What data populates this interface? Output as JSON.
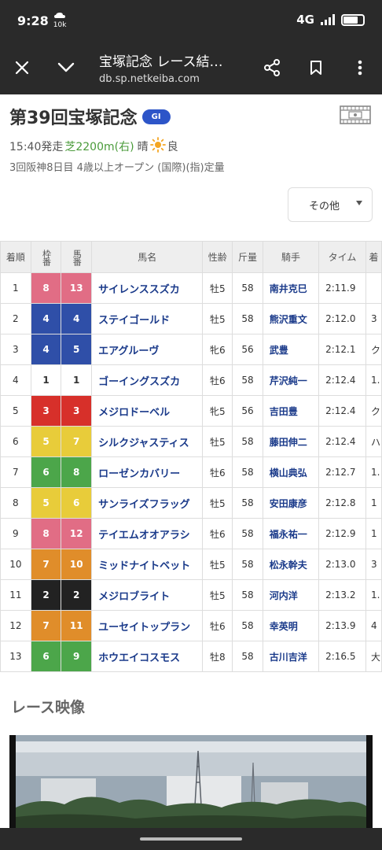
{
  "status": {
    "time": "9:28",
    "sub_label": "10k",
    "network": "4G"
  },
  "appbar": {
    "title": "宝塚記念 レース結…",
    "url": "db.sp.netkeiba.com"
  },
  "race": {
    "title": "第39回宝塚記念",
    "grade": "GI",
    "start": "15:40発走",
    "course": "芝2200m(右)",
    "weather": "晴",
    "going": "良",
    "details": "3回阪神8日目 4歳以上オープン (国際)(指)定量"
  },
  "other_button": "その他",
  "table": {
    "headers": [
      "着順",
      "枠番",
      "馬番",
      "馬名",
      "性齢",
      "斤量",
      "騎手",
      "タイム",
      "着"
    ],
    "rows": [
      {
        "rank": "1",
        "frame": "8",
        "frame_color": "pink",
        "num": "13",
        "name": "サイレンススズカ",
        "sex": "牡5",
        "kin": "58",
        "jockey": "南井克巳",
        "time": "2:11.9",
        "margin": ""
      },
      {
        "rank": "2",
        "frame": "4",
        "frame_color": "blue",
        "num": "4",
        "name": "ステイゴールド",
        "sex": "牡5",
        "kin": "58",
        "jockey": "熊沢重文",
        "time": "2:12.0",
        "margin": "3"
      },
      {
        "rank": "3",
        "frame": "4",
        "frame_color": "blue",
        "num": "5",
        "name": "エアグルーヴ",
        "sex": "牝6",
        "kin": "56",
        "jockey": "武豊",
        "time": "2:12.1",
        "margin": "ク"
      },
      {
        "rank": "4",
        "frame": "1",
        "frame_color": "white",
        "num": "1",
        "name": "ゴーイングスズカ",
        "sex": "牡6",
        "kin": "58",
        "jockey": "芹沢純一",
        "time": "2:12.4",
        "margin": "1."
      },
      {
        "rank": "5",
        "frame": "3",
        "frame_color": "red",
        "num": "3",
        "name": "メジロドーベル",
        "sex": "牝5",
        "kin": "56",
        "jockey": "吉田豊",
        "time": "2:12.4",
        "margin": "ク"
      },
      {
        "rank": "6",
        "frame": "5",
        "frame_color": "yellow",
        "num": "7",
        "name": "シルクジャスティス",
        "sex": "牡5",
        "kin": "58",
        "jockey": "藤田伸二",
        "time": "2:12.4",
        "margin": "ハ"
      },
      {
        "rank": "7",
        "frame": "6",
        "frame_color": "green",
        "num": "8",
        "name": "ローゼンカバリー",
        "sex": "牡6",
        "kin": "58",
        "jockey": "横山典弘",
        "time": "2:12.7",
        "margin": "1."
      },
      {
        "rank": "8",
        "frame": "5",
        "frame_color": "yellow",
        "num": "6",
        "name": "サンライズフラッグ",
        "sex": "牡5",
        "kin": "58",
        "jockey": "安田康彦",
        "time": "2:12.8",
        "margin": "1"
      },
      {
        "rank": "9",
        "frame": "8",
        "frame_color": "pink",
        "num": "12",
        "name": "テイエムオオアラシ",
        "sex": "牡6",
        "kin": "58",
        "jockey": "福永祐一",
        "time": "2:12.9",
        "margin": "1"
      },
      {
        "rank": "10",
        "frame": "7",
        "frame_color": "orange",
        "num": "10",
        "name": "ミッドナイトベット",
        "sex": "牡5",
        "kin": "58",
        "jockey": "松永幹夫",
        "time": "2:13.0",
        "margin": "3"
      },
      {
        "rank": "11",
        "frame": "2",
        "frame_color": "black",
        "num": "2",
        "name": "メジロブライト",
        "sex": "牡5",
        "kin": "58",
        "jockey": "河内洋",
        "time": "2:13.2",
        "margin": "1."
      },
      {
        "rank": "12",
        "frame": "7",
        "frame_color": "orange",
        "num": "11",
        "name": "ユーセイトップラン",
        "sex": "牡6",
        "kin": "58",
        "jockey": "幸英明",
        "time": "2:13.9",
        "margin": "4"
      },
      {
        "rank": "13",
        "frame": "6",
        "frame_color": "green",
        "num": "9",
        "name": "ホウエイコスモス",
        "sex": "牡8",
        "kin": "58",
        "jockey": "古川吉洋",
        "time": "2:16.5",
        "margin": "大"
      }
    ]
  },
  "video_title": "レース映像"
}
